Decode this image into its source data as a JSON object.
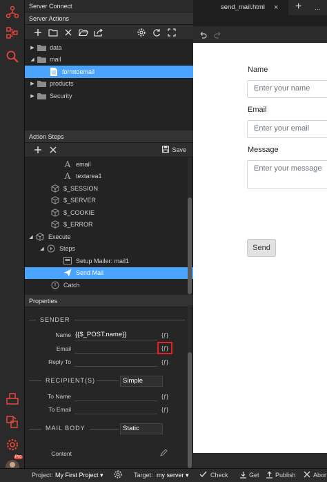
{
  "panel": {
    "title": "Server Connect",
    "server_actions_title": "Server Actions",
    "tree": [
      {
        "label": "data"
      },
      {
        "label": "mail"
      },
      {
        "label": "formtoemail"
      },
      {
        "label": "products"
      },
      {
        "label": "Security"
      }
    ],
    "action_steps_title": "Action Steps",
    "save_label": "Save",
    "steps": [
      {
        "label": "email"
      },
      {
        "label": "textarea1"
      },
      {
        "label": "$_SESSION"
      },
      {
        "label": "$_SERVER"
      },
      {
        "label": "$_COOKIE"
      },
      {
        "label": "$_ERROR"
      },
      {
        "label": "Execute"
      },
      {
        "label": "Steps"
      },
      {
        "label": "Setup Mailer: mail1"
      },
      {
        "label": "Send Mail"
      },
      {
        "label": "Catch"
      }
    ],
    "properties_title": "Properties"
  },
  "properties": {
    "sender_title": "SENDER",
    "name_label": "Name",
    "name_value": "{{$_POST.name}}",
    "email_label": "Email",
    "reply_to_label": "Reply To",
    "recipients_title": "RECIPIENT(S)",
    "recipients_mode": "Simple",
    "to_name_label": "To Name",
    "to_email_label": "To Email",
    "mail_body_title": "MAIL BODY",
    "mail_body_mode": "Static",
    "content_label": "Content",
    "dynamic_glyph": "{ƒ}"
  },
  "editor": {
    "tab_title": "send_mail.html",
    "tab_close": "×",
    "tab_add": "+",
    "tab_more": "…"
  },
  "form": {
    "name_label": "Name",
    "name_placeholder": "Enter your name",
    "email_label": "Email",
    "email_placeholder": "Enter your email",
    "message_label": "Message",
    "message_placeholder": "Enter your message",
    "send_label": "Send"
  },
  "status": {
    "project_label": "Project:",
    "project_value": "My First Project ▾",
    "target_label": "Target:",
    "target_value": "my server ▾",
    "check_label": "Check",
    "get_label": "Get",
    "publish_label": "Publish",
    "abort_label": "Abor"
  },
  "avatar_badge": "Pro",
  "colors": {
    "accent": "#4aa3ff",
    "brand_red": "#e8473a",
    "highlight_border": "#e32222"
  }
}
